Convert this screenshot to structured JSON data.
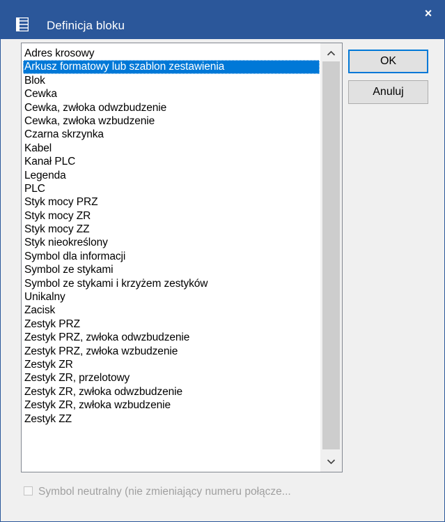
{
  "window": {
    "title": "Definicja bloku",
    "close_label": "×",
    "accent_color": "#2b579a",
    "selection_color": "#0078d7"
  },
  "list": {
    "selected_index": 1,
    "items": [
      "Adres krosowy",
      "Arkusz formatowy lub szablon zestawienia",
      "Blok",
      "Cewka",
      "Cewka, zwłoka odwzbudzenie",
      "Cewka, zwłoka wzbudzenie",
      "Czarna skrzynka",
      "Kabel",
      "Kanał PLC",
      "Legenda",
      "PLC",
      "Styk mocy PRZ",
      "Styk mocy ZR",
      "Styk mocy ZZ",
      "Styk nieokreślony",
      "Symbol dla informacji",
      "Symbol ze stykami",
      "Symbol ze stykami i krzyżem zestyków",
      "Unikalny",
      "Zacisk",
      "Zestyk PRZ",
      "Zestyk PRZ, zwłoka odwzbudzenie",
      "Zestyk PRZ, zwłoka wzbudzenie",
      "Zestyk ZR",
      "Zestyk ZR, przelotowy",
      "Zestyk ZR, zwłoka odwzbudzenie",
      "Zestyk ZR, zwłoka wzbudzenie",
      "Zestyk ZZ"
    ],
    "scroll_up_icon": "chevron-up-icon",
    "scroll_down_icon": "chevron-down-icon"
  },
  "buttons": {
    "ok_label": "OK",
    "cancel_label": "Anuluj"
  },
  "checkbox": {
    "label": "Symbol neutralny (nie zmieniający numeru połącze...",
    "checked": false,
    "enabled": false
  }
}
